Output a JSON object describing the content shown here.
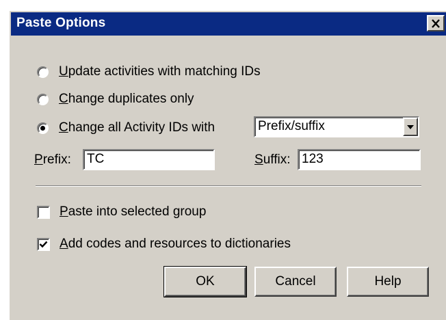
{
  "dialog": {
    "title": "Paste Options",
    "close_glyph": "X"
  },
  "options": {
    "radio_update": {
      "label_key": "U",
      "label_rest": "pdate activities with matching IDs",
      "selected": false
    },
    "radio_duplicates": {
      "label_key": "C",
      "label_rest": "hange duplicates only",
      "selected": false
    },
    "radio_change_all": {
      "label_key": "C",
      "label_rest": "hange all Activity IDs with",
      "selected": true
    },
    "mode_select": {
      "value": "Prefix/suffix"
    }
  },
  "prefix": {
    "label_key": "P",
    "label_rest": "refix:",
    "value": "TC"
  },
  "suffix": {
    "label_key": "S",
    "label_rest": "uffix:",
    "value": "123"
  },
  "checks": {
    "paste_group": {
      "label_key": "P",
      "label_rest": "aste into selected group",
      "checked": false
    },
    "add_codes": {
      "label_key": "A",
      "label_rest": "dd codes and resources to dictionaries",
      "checked": true
    }
  },
  "buttons": {
    "ok": "OK",
    "cancel": "Cancel",
    "help": "Help"
  },
  "colors": {
    "titlebar": "#0a2a83",
    "face": "#d4d0c8"
  }
}
